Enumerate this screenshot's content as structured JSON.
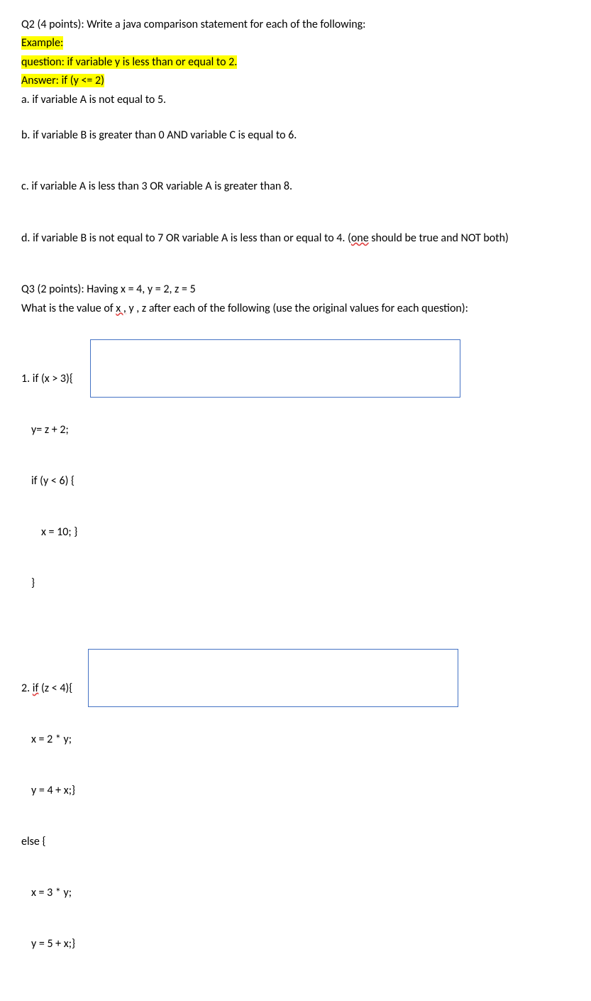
{
  "q2": {
    "header": "Q2 (4 points): Write a java comparison statement for each of the following:",
    "example_label": "Example:",
    "example_question": "question: if variable y is less than or equal to 2.",
    "example_answer": " Answer: if (y <= 2)",
    "a": "a. if variable A is not equal to 5.",
    "b": "b. if variable B is greater than 0 AND variable C is equal to 6.",
    "c": "c. if variable A is less than 3 OR variable A is greater than 8.",
    "d_pre": "d. if variable B is not equal to 7 OR variable A is less than or equal to 4. (",
    "d_sq": "one",
    "d_post": " should be true and NOT both)"
  },
  "q3": {
    "header": "Q3 (2 points): Having x = 4, y = 2, z = 5",
    "prompt_pre": "What is the value of ",
    "prompt_sq": "x ,",
    "prompt_post": " y , z after each of the following (use the original values for each question):",
    "p1": {
      "l1": "1. if (x > 3){",
      "l2": "y= z + 2;",
      "l3": "if (y < 6) {",
      "l4": "x = 10; }",
      "l5": "}"
    },
    "p2": {
      "l1_pre": "2. ",
      "l1_sq": "if",
      "l1_post": " (z < 4){",
      "l2": "x = 2 * y;",
      "l3": "y = 4 + x;}",
      "l4": "else {",
      "l5": "x = 3 * y;",
      "l6": "y = 5 + x;}"
    }
  }
}
